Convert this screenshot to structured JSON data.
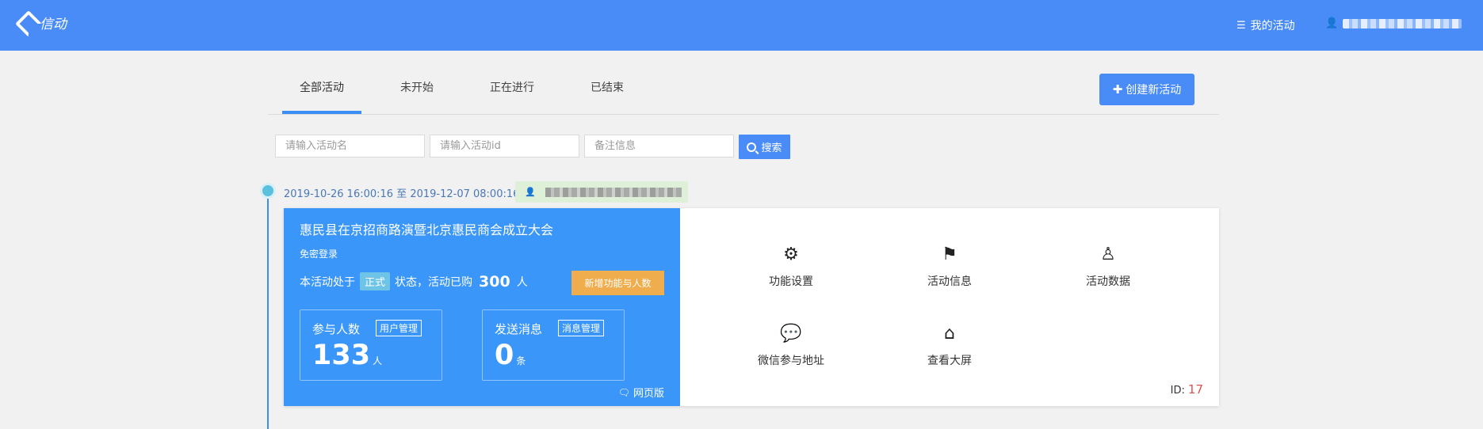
{
  "header": {
    "brand": "信动",
    "my_activities": "我的活动",
    "user_name": ""
  },
  "tabs": [
    {
      "label": "全部活动",
      "active": true
    },
    {
      "label": "未开始",
      "active": false
    },
    {
      "label": "正在进行",
      "active": false
    },
    {
      "label": "已结束",
      "active": false
    }
  ],
  "create_button": "创建新活动",
  "search": {
    "name_placeholder": "请输入活动名",
    "id_placeholder": "请输入活动id",
    "note_placeholder": "备注信息",
    "button": "搜索"
  },
  "activity": {
    "time_range": "2019-10-26 16:00:16 至 2019-12-07 08:00:16",
    "title": "惠民县在京招商路演暨北京惠民商会成立大会",
    "login_mode": "免密登录",
    "status_prefix": "本活动处于",
    "status": "正式",
    "status_mid": "状态，活动已购",
    "purchased": "300",
    "purchased_unit": "人",
    "add_func_button": "新增功能与人数",
    "participants_label": "参与人数",
    "participants_mgmt": "用户管理",
    "participants_count": "133",
    "participants_unit": "人",
    "messages_label": "发送消息",
    "messages_mgmt": "消息管理",
    "messages_count": "0",
    "messages_unit": "条",
    "web_version": "网页版",
    "functions": [
      {
        "label": "功能设置",
        "icon": "gear-icon",
        "glyph": "⚙"
      },
      {
        "label": "活动信息",
        "icon": "flag-icon",
        "glyph": "⚑"
      },
      {
        "label": "活动数据",
        "icon": "user-outline-icon",
        "glyph": "♙"
      },
      {
        "label": "微信参与地址",
        "icon": "wechat-icon",
        "glyph": "💬"
      },
      {
        "label": "查看大屏",
        "icon": "screen-icon",
        "glyph": "⌂"
      }
    ],
    "id_label": "ID:",
    "id_value": "17"
  }
}
